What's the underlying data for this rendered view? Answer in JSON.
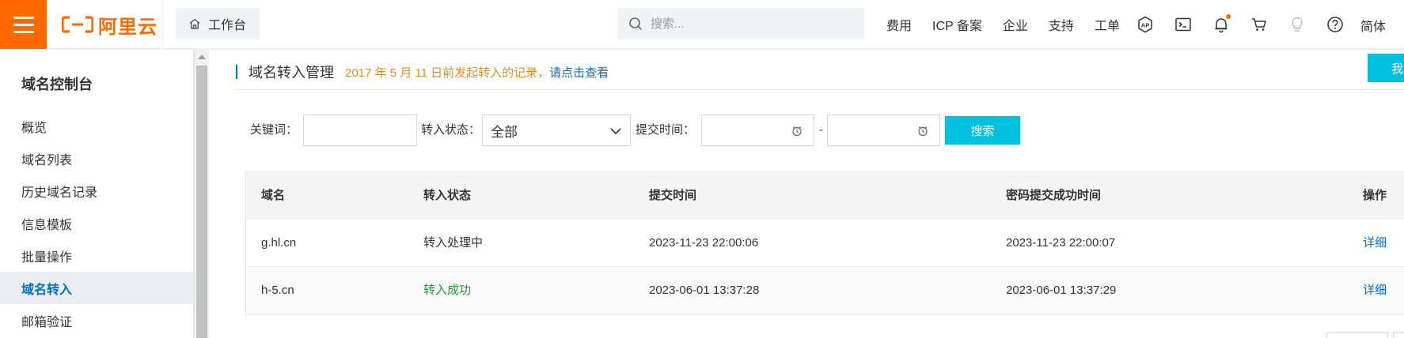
{
  "header": {
    "brand": "阿里云",
    "workbench_label": "工作台",
    "search_placeholder": "搜索...",
    "nav": [
      "费用",
      "ICP 备案",
      "企业",
      "支持",
      "工单"
    ],
    "language": "简体",
    "icons": [
      "ap-icon",
      "terminal-icon",
      "bell-icon",
      "cart-icon",
      "lightbulb-icon",
      "help-icon"
    ],
    "accent_color": "#ff6a00"
  },
  "sidebar": {
    "title": "域名控制台",
    "items": [
      {
        "label": "概览",
        "active": false
      },
      {
        "label": "域名列表",
        "active": false
      },
      {
        "label": "历史域名记录",
        "active": false
      },
      {
        "label": "信息模板",
        "active": false
      },
      {
        "label": "批量操作",
        "active": false
      },
      {
        "label": "域名转入",
        "active": true
      },
      {
        "label": "邮箱验证",
        "active": false
      }
    ]
  },
  "main": {
    "title": "域名转入管理",
    "notice": "2017 年 5 月 11 日前发起转入的记录，",
    "notice_link": "请点击查看",
    "corner_button": "我",
    "filters": {
      "keyword_label": "关键词：",
      "keyword_value": "",
      "status_label": "转入状态：",
      "status_selected": "全部",
      "time_label": "提交时间：",
      "time_separator": "-",
      "search_button": "搜索"
    },
    "table": {
      "columns": [
        "域名",
        "转入状态",
        "提交时间",
        "密码提交成功时间",
        "操作"
      ],
      "rows": [
        {
          "domain": "g.hl.cn",
          "status": "转入处理中",
          "submit_time": "2023-11-23 22:00:06",
          "password_time": "2023-11-23 22:00:07",
          "action": "详细"
        },
        {
          "domain": "h-5.cn",
          "status": "转入成功",
          "submit_time": "2023-06-01 13:37:28",
          "password_time": "2023-06-01 13:37:29",
          "action": "详细"
        }
      ]
    },
    "colors": {
      "link": "#0070cc",
      "primary_button": "#00c1de",
      "notice": "#e48d1c",
      "success": "#1e9b2b"
    }
  }
}
